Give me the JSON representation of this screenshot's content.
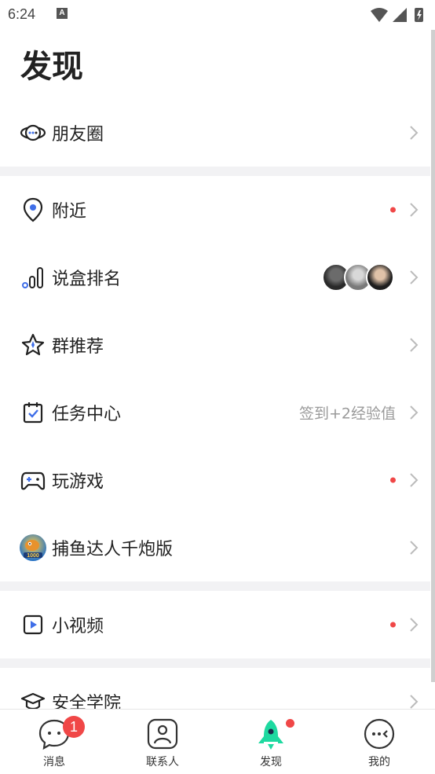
{
  "status_bar": {
    "time": "6:24",
    "notif_letter": "A"
  },
  "header": {
    "title": "发现"
  },
  "rows": [
    {
      "label": "朋友圈",
      "icon": "planet-chat-icon"
    },
    {
      "label": "附近",
      "icon": "location-pin-icon",
      "dot": true
    },
    {
      "label": "说盒排名",
      "icon": "ranking-bars-icon",
      "avatars": 3
    },
    {
      "label": "群推荐",
      "icon": "star-icon"
    },
    {
      "label": "任务中心",
      "icon": "calendar-check-icon",
      "hint": "签到+2经验值"
    },
    {
      "label": "玩游戏",
      "icon": "gamepad-icon",
      "dot": true
    },
    {
      "label": "捕鱼达人千炮版",
      "icon": "fishing-game-icon"
    },
    {
      "label": "小视频",
      "icon": "video-play-icon",
      "dot": true
    },
    {
      "label": "安全学院",
      "icon": "graduation-cap-icon"
    }
  ],
  "nav": {
    "tabs": [
      {
        "label": "消息",
        "badge": "1"
      },
      {
        "label": "联系人"
      },
      {
        "label": "发现"
      },
      {
        "label": "我的"
      }
    ]
  },
  "colors": {
    "accent": "#1ed9a0",
    "badge": "#f04747",
    "icon_blue": "#3f6ee8"
  }
}
